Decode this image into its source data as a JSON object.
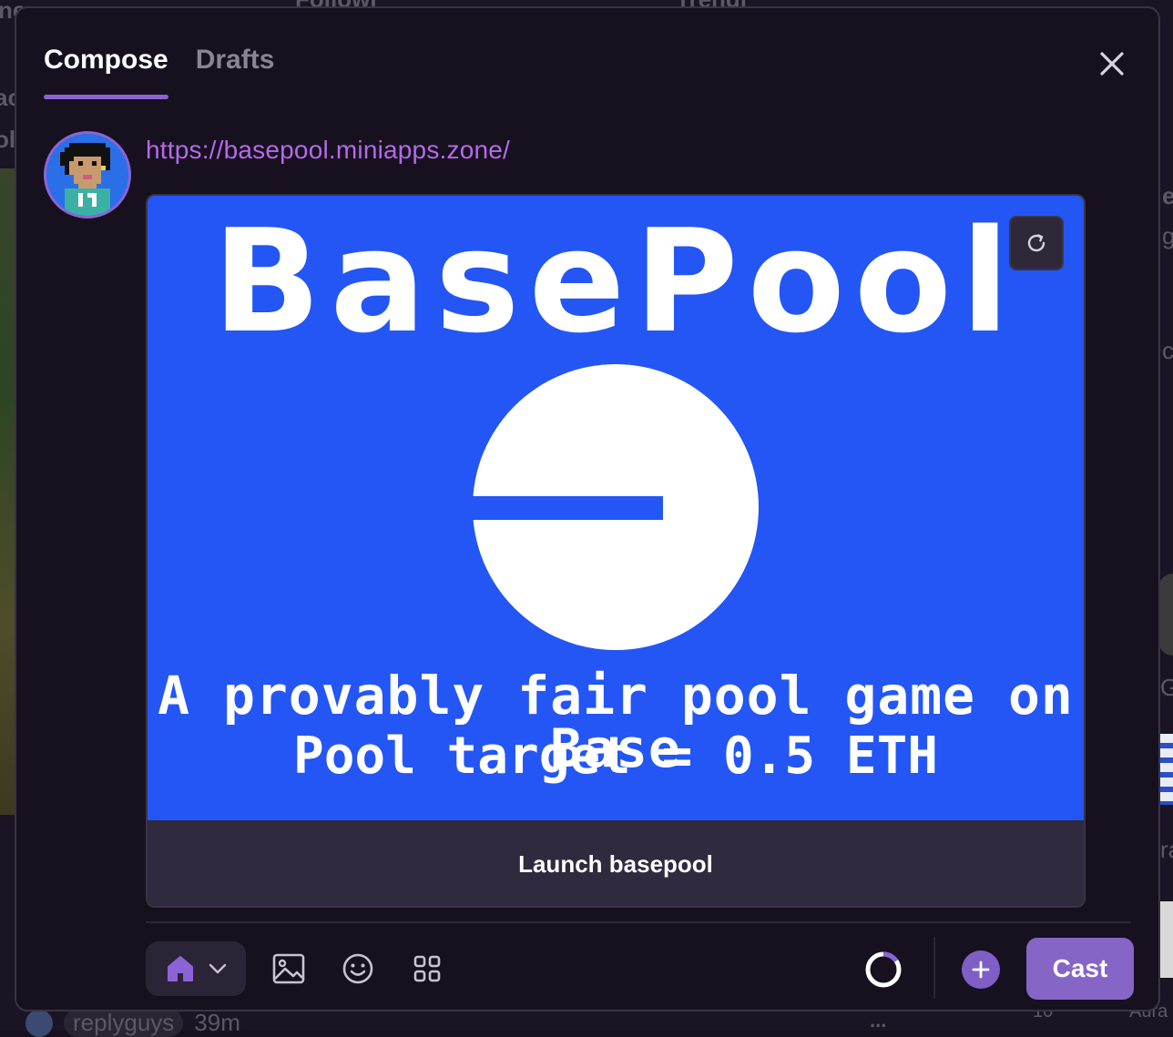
{
  "background": {
    "frag_top_left": "ne",
    "frag_top_mid1": "Followi",
    "frag_top_mid2": "Trendi",
    "frag_left_1": "ac",
    "frag_left_2": "ol",
    "frag_right_1": "e",
    "frag_right_2": "g",
    "frag_right_3": "c",
    "frag_right_4": "G",
    "frag_right_5": "ra",
    "frag_right_6": "Aura",
    "frag_bottom_num": "10",
    "bottom_user": "replyguys",
    "bottom_time": "39m",
    "bottom_more": "..."
  },
  "tabs": [
    {
      "label": "Compose",
      "active": true
    },
    {
      "label": "Drafts",
      "active": false
    }
  ],
  "compose": {
    "text": "https://basepool.miniapps.zone/"
  },
  "embed": {
    "title": "BasePool",
    "line1": "A provably fair pool game on Base",
    "line2": "Pool target = 0.5 ETH",
    "button_label": "Launch basepool",
    "bg_color": "#2356f5"
  },
  "toolbar": {
    "channel_icon": "home-icon",
    "cast_label": "Cast"
  },
  "colors": {
    "accent": "#8c63d6",
    "link": "#b46ae8"
  }
}
